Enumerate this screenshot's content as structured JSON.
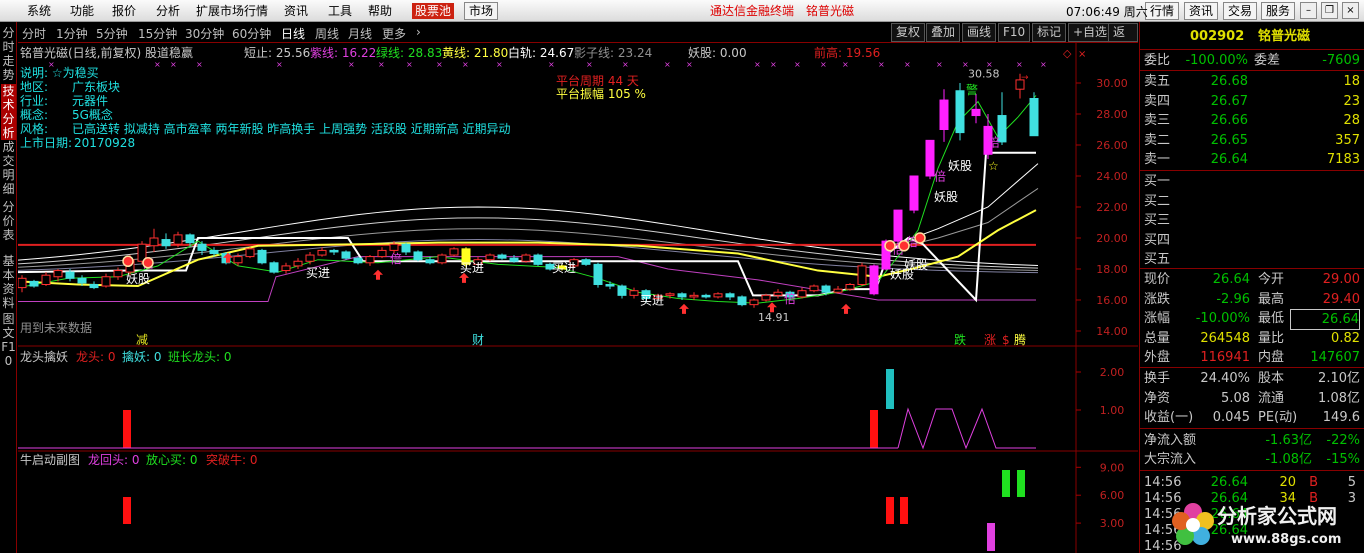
{
  "menu": {
    "items": [
      "系统",
      "功能",
      "报价",
      "分析",
      "扩展市场行情",
      "资讯",
      "工具",
      "帮助"
    ],
    "stockpool": "股票池",
    "market": "市场",
    "promo": "通达信金融终端",
    "stockname": "铭普光磁",
    "time": "07:06:49",
    "weekday": "周六",
    "right": [
      "行情",
      "资讯",
      "交易",
      "服务"
    ]
  },
  "lefttabs": [
    "分时走势",
    "技术分析",
    "成交明细",
    "分价表",
    "基本资料",
    "图文F10"
  ],
  "periods": [
    "分时",
    "1分钟",
    "5分钟",
    "15分钟",
    "30分钟",
    "60分钟",
    "日线",
    "周线",
    "月线",
    "更多"
  ],
  "toolbar": [
    "复权",
    "叠加",
    "画线",
    "F10",
    "标记",
    "+自选",
    "返回"
  ],
  "header": {
    "title": "铭普光磁(日线,前复权) 股道稳赢",
    "items": [
      {
        "t": "短止: 25.56",
        "c": "#c8c8c8"
      },
      {
        "t": "紫线: 16.22",
        "c": "#e040e0"
      },
      {
        "t": "绿线: 28.83",
        "c": "#20e020"
      },
      {
        "t": "黄线: 21.80",
        "c": "#ffff40"
      },
      {
        "t": "白轨: 24.67",
        "c": "#ffffff"
      },
      {
        "t": "影子线: 23.24",
        "c": "#909090"
      },
      {
        "t": "妖股: 0.00",
        "c": "#c8c8c8"
      },
      {
        "t": "前高: 19.56",
        "c": "#e02020"
      }
    ]
  },
  "info": {
    "label": "说明: ☆为稳买",
    "rows": [
      [
        "地区:",
        "广东板块"
      ],
      [
        "行业:",
        "元器件"
      ],
      [
        "概念:",
        "5G概念"
      ],
      [
        "风格:",
        "已高送转 拟减持 高市盈率 两年新股 昨高换手 上周强势 活跃股 近期新高 近期异动"
      ],
      [
        "上市日期:",
        "20170928"
      ]
    ]
  },
  "platform": {
    "period": "平台周期 44 天",
    "amp": "平台振幅 105 %"
  },
  "labels": {
    "future": "用到未来数据",
    "high": "30.58",
    "low": "14.91",
    "mark_jian": "减",
    "mark_cai": "财",
    "mark_die": "跌",
    "mark_zhang": "涨",
    "mark_s": "$",
    "mark_teng": "腾"
  },
  "yaxis": [
    "30.00",
    "28.00",
    "26.00",
    "24.00",
    "22.00",
    "20.00",
    "18.00",
    "16.00",
    "14.00"
  ],
  "signals": {
    "mai": "买进",
    "yao": "妖股",
    "bei": "倍",
    "jing": "警"
  },
  "panel2": {
    "title": "龙头擒妖",
    "items": [
      {
        "t": "龙头: 0",
        "c": "#e02020"
      },
      {
        "t": "擒妖: 0",
        "c": "#40e0e0"
      },
      {
        "t": "班长龙头: 0",
        "c": "#20e020"
      }
    ],
    "y": [
      "2.00",
      "1.00"
    ]
  },
  "panel3": {
    "title": "牛启动副图",
    "items": [
      {
        "t": "龙回头: 0",
        "c": "#e040e0"
      },
      {
        "t": "放心买: 0",
        "c": "#20e020"
      },
      {
        "t": "突破牛: 0",
        "c": "#e02020"
      }
    ],
    "y": [
      "9.00",
      "6.00",
      "3.00"
    ]
  },
  "quote": {
    "code": "002902",
    "name": "铭普光磁",
    "weibi_l": "委比",
    "weibi": "-100.00%",
    "weicha_l": "委差",
    "weicha": "-7609",
    "sells": [
      [
        "卖五",
        "26.68",
        "18"
      ],
      [
        "卖四",
        "26.67",
        "23"
      ],
      [
        "卖三",
        "26.66",
        "28"
      ],
      [
        "卖二",
        "26.65",
        "357"
      ],
      [
        "卖一",
        "26.64",
        "7183"
      ]
    ],
    "buys": [
      "买一",
      "买二",
      "买三",
      "买四",
      "买五"
    ],
    "stats": [
      [
        "现价",
        "26.64",
        "今开",
        "29.00"
      ],
      [
        "涨跌",
        "-2.96",
        "最高",
        "29.40"
      ],
      [
        "涨幅",
        "-10.00%",
        "最低",
        "26.64"
      ],
      [
        "总量",
        "264548",
        "量比",
        "0.82"
      ],
      [
        "外盘",
        "116941",
        "内盘",
        "147607"
      ]
    ],
    "fund": [
      [
        "换手",
        "24.40%",
        "股本",
        "2.10亿"
      ],
      [
        "净资",
        "5.08",
        "流通",
        "1.08亿"
      ],
      [
        "收益(一)",
        "0.045",
        "PE(动)",
        "149.6"
      ]
    ],
    "flow": [
      [
        "净流入额",
        "-1.63亿",
        "-22%"
      ],
      [
        "大宗流入",
        "-1.08亿",
        "-15%"
      ]
    ],
    "ticks": [
      [
        "14:56",
        "26.64",
        "20",
        "B",
        "5"
      ],
      [
        "14:56",
        "26.64",
        "34",
        "B",
        "3"
      ],
      [
        "14:56",
        "26.64",
        "",
        "",
        " "
      ],
      [
        "14:56",
        "26.64",
        "",
        "",
        " "
      ],
      [
        "14:56",
        "",
        "",
        "",
        ""
      ]
    ]
  },
  "logo": {
    "text": "分析家公式网",
    "url": "www.88gs.com"
  }
}
